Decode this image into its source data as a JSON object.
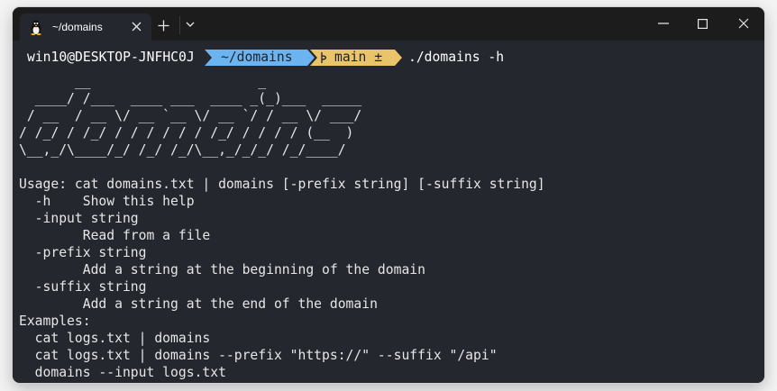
{
  "window": {
    "tab_title": "~/domains",
    "tab_icon": "linux-penguin-icon"
  },
  "prompt": {
    "user_host": "win10@DESKTOP-JNFHC0J",
    "path": "~/domains",
    "branch": "main ±",
    "command": "./domains -h",
    "path_color": "#6cb4f0",
    "branch_color": "#e9c46a"
  },
  "output": {
    "banner": [
      "       __                     _",
      "  ____/ /___  ____ ___  ____ _(_)___  _____",
      " / __  / __ \\/ __ `__ \\/ __ `/ / __ \\/ ___/",
      "/ /_/ / /_/ / / / / / / /_/ / / / / (__  )",
      "\\__,_/\\____/_/ /_/ /_/\\__,_/_/_/ /_/____/"
    ],
    "help": [
      "Usage: cat domains.txt | domains [-prefix string] [-suffix string]",
      "  -h    Show this help",
      "  -input string",
      "        Read from a file",
      "  -prefix string",
      "        Add a string at the beginning of the domain",
      "  -suffix string",
      "        Add a string at the end of the domain",
      "Examples:",
      "  cat logs.txt | domains",
      "  cat logs.txt | domains --prefix \"https://\" --suffix \"/api\"",
      "  domains --input logs.txt"
    ]
  }
}
